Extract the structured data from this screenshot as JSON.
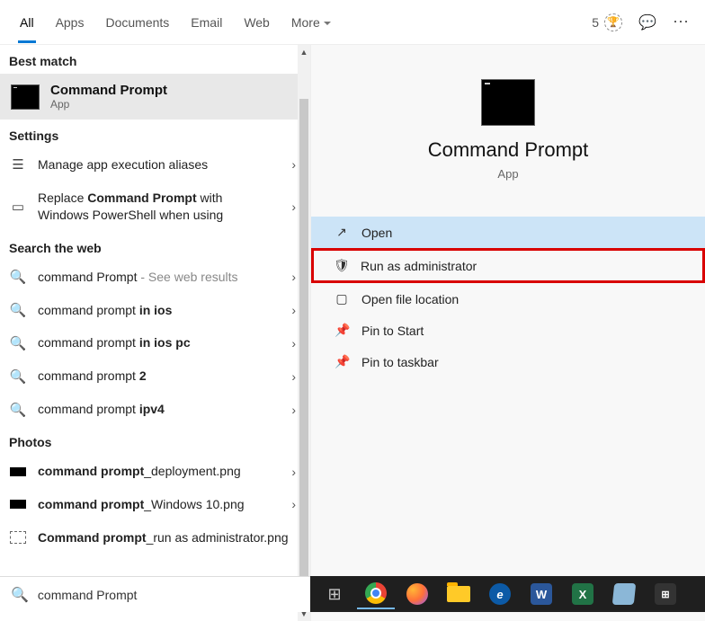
{
  "tabs": {
    "all": "All",
    "apps": "Apps",
    "docs": "Documents",
    "email": "Email",
    "web": "Web",
    "more": "More"
  },
  "topbar": {
    "rewards_count": "5"
  },
  "sections": {
    "best": "Best match",
    "settings": "Settings",
    "web": "Search the web",
    "photos": "Photos"
  },
  "best_match": {
    "title": "Command Prompt",
    "type": "App"
  },
  "settings_rows": {
    "aliases": "Manage app execution aliases",
    "replace_pre": "Replace ",
    "replace_bold": "Command Prompt",
    "replace_post": " with Windows PowerShell when using"
  },
  "web_rows": {
    "r1_pre": "command Prompt",
    "r1_hint": " - See web results",
    "r2_pre": "command prompt ",
    "r2_b": "in ios",
    "r3_pre": "command prompt ",
    "r3_b": "in ios pc",
    "r4_pre": "command prompt ",
    "r4_b": "2",
    "r5_pre": "command prompt ",
    "r5_b": "ipv4"
  },
  "photos_rows": {
    "p1_b": "command prompt",
    "p1_post": "_deployment.png",
    "p2_b": "command prompt",
    "p2_post": "_Windows 10.png",
    "p3_b": "Command prompt",
    "p3_post": "_run as administrator.png"
  },
  "preview": {
    "title": "Command Prompt",
    "type": "App"
  },
  "actions": {
    "open": "Open",
    "admin": "Run as administrator",
    "loc": "Open file location",
    "pinstart": "Pin to Start",
    "pintask": "Pin to taskbar"
  },
  "search_value": "command Prompt"
}
